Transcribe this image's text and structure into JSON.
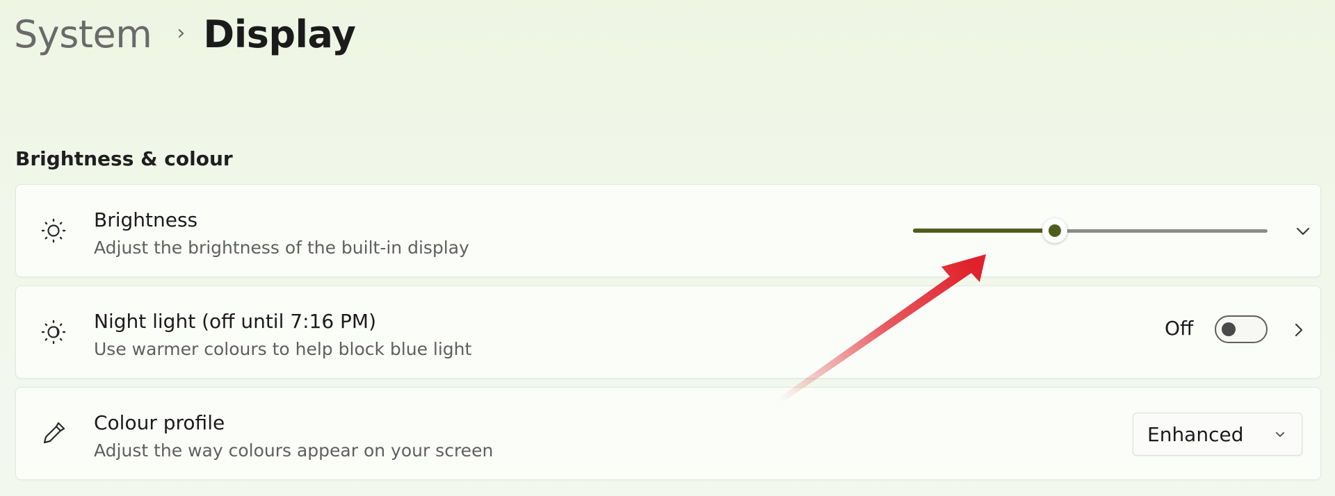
{
  "breadcrumb": {
    "parent": "System",
    "separator": "›",
    "current": "Display"
  },
  "section": {
    "title": "Brightness & colour"
  },
  "brightness": {
    "title": "Brightness",
    "description": "Adjust the brightness of the built-in display",
    "level_percent": 40,
    "icon": "sun-icon",
    "expand_icon": "chevron-down-icon"
  },
  "night_light": {
    "title": "Night light (off until 7:16 PM)",
    "description": "Use warmer colours to help block blue light",
    "toggle_label": "Off",
    "toggle_on": false,
    "icon": "night-light-icon",
    "nav_icon": "chevron-right-icon"
  },
  "colour_profile": {
    "title": "Colour profile",
    "description": "Adjust the way colours appear on your screen",
    "selected": "Enhanced",
    "icon": "eyedropper-icon",
    "dropdown_icon": "chevron-down-icon"
  },
  "colors": {
    "accent": "#4f5d1c",
    "annotation_arrow": "#e0212b"
  }
}
